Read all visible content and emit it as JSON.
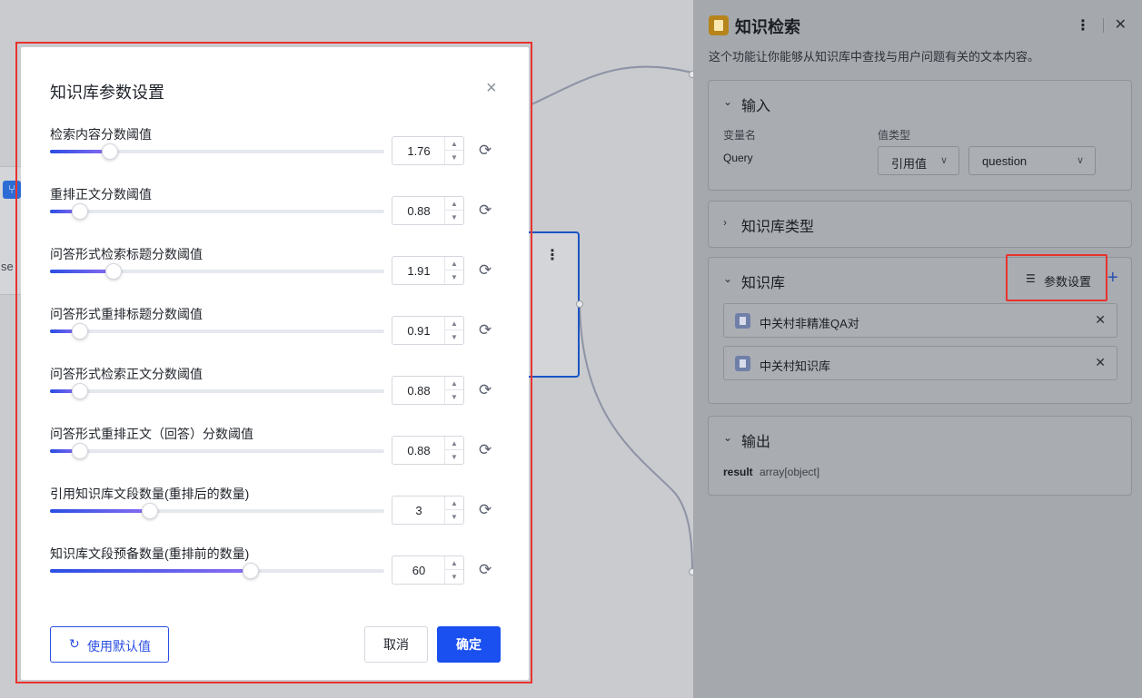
{
  "canvas": {
    "left_node_text": "se",
    "left_node_icon": "branch-icon",
    "mid_node_more": "⋮"
  },
  "panel": {
    "title": "知识检索",
    "description": "这个功能让你能够从知识库中查找与用户问题有关的文本内容。",
    "more": "⋮",
    "close": "✕",
    "input_section": {
      "title": "输入",
      "col_var_name": "变量名",
      "col_value_type": "值类型",
      "var_name": "Query",
      "value_type": "引用值",
      "value": "question"
    },
    "kb_type_section": {
      "title": "知识库类型"
    },
    "kb_section": {
      "title": "知识库",
      "param_button": "参数设置",
      "add": "+",
      "items": [
        {
          "name": "中关村非精准QA对"
        },
        {
          "name": "中关村知识库"
        }
      ]
    },
    "output_section": {
      "title": "输出",
      "name": "result",
      "type": "array[object]"
    }
  },
  "modal": {
    "title": "知识库参数设置",
    "close": "×",
    "rows": [
      {
        "label": "检索内容分数阈值",
        "value": "1.76",
        "fraction": 0.18
      },
      {
        "label": "重排正文分数阈值",
        "value": "0.88",
        "fraction": 0.09
      },
      {
        "label": "问答形式检索标题分数阈值",
        "value": "1.91",
        "fraction": 0.19
      },
      {
        "label": "问答形式重排标题分数阈值",
        "value": "0.91",
        "fraction": 0.09
      },
      {
        "label": "问答形式检索正文分数阈值",
        "value": "0.88",
        "fraction": 0.09
      },
      {
        "label": "问答形式重排正文（回答）分数阈值",
        "value": "0.88",
        "fraction": 0.09
      },
      {
        "label": "引用知识库文段数量(重排后的数量)",
        "value": "3",
        "fraction": 0.3
      },
      {
        "label": "知识库文段预备数量(重排前的数量)",
        "value": "60",
        "fraction": 0.6
      }
    ],
    "default_button": "使用默认值",
    "cancel_button": "取消",
    "ok_button": "确定"
  }
}
